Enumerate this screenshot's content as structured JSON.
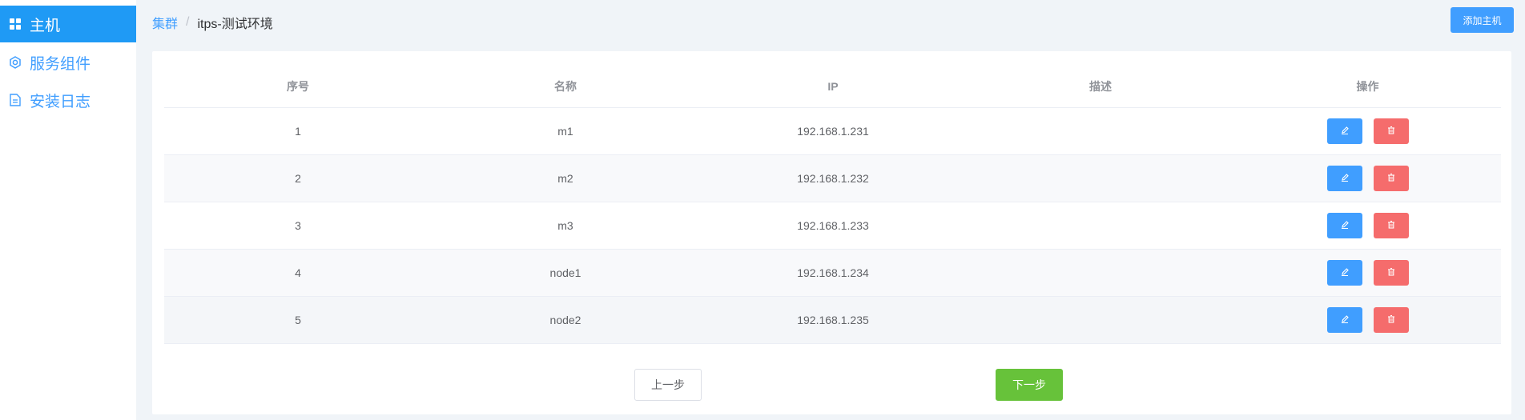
{
  "sidebar": {
    "items": [
      {
        "label": "主机",
        "icon": "grid-icon",
        "active": true
      },
      {
        "label": "服务组件",
        "icon": "gear-icon",
        "active": false
      },
      {
        "label": "安装日志",
        "icon": "document-icon",
        "active": false
      }
    ]
  },
  "breadcrumb": {
    "parent": "集群",
    "separator": "/",
    "current": "itps-测试环境"
  },
  "header": {
    "add_label": "添加主机"
  },
  "table": {
    "columns": [
      "序号",
      "名称",
      "IP",
      "描述",
      "操作"
    ],
    "rows": [
      {
        "index": "1",
        "name": "m1",
        "ip": "192.168.1.231",
        "desc": ""
      },
      {
        "index": "2",
        "name": "m2",
        "ip": "192.168.1.232",
        "desc": ""
      },
      {
        "index": "3",
        "name": "m3",
        "ip": "192.168.1.233",
        "desc": ""
      },
      {
        "index": "4",
        "name": "node1",
        "ip": "192.168.1.234",
        "desc": ""
      },
      {
        "index": "5",
        "name": "node2",
        "ip": "192.168.1.235",
        "desc": ""
      }
    ],
    "row_actions": [
      "edit-icon",
      "delete-icon"
    ]
  },
  "footer": {
    "prev_label": "上一步",
    "next_label": "下一步"
  },
  "colors": {
    "primary": "#409eff",
    "sidebar_active": "#1f9af5",
    "danger": "#f56c6c",
    "success": "#67c23a"
  }
}
